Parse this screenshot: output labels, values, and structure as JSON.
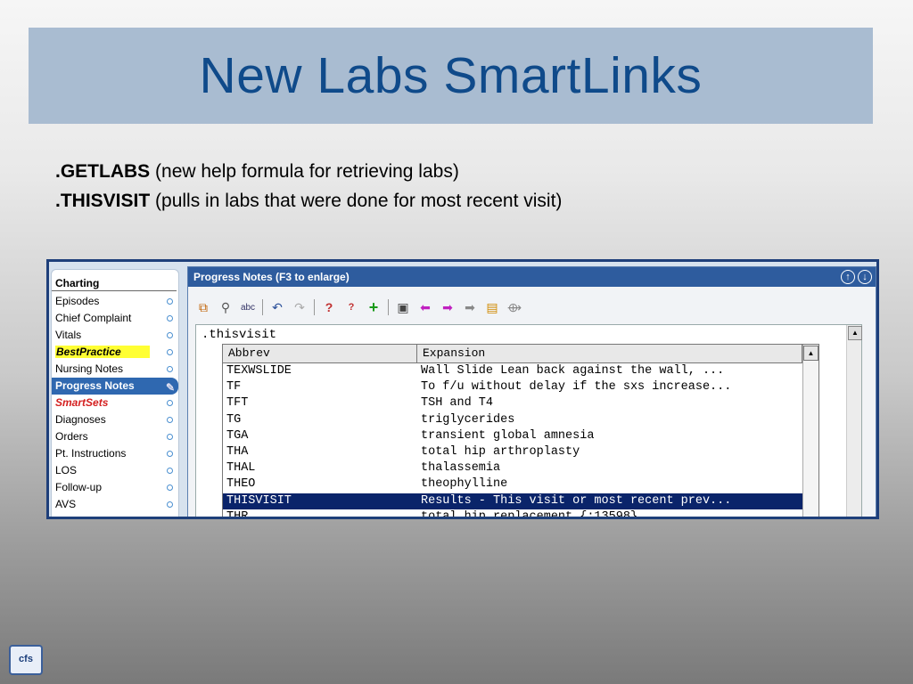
{
  "slide": {
    "title": "New Labs SmartLinks",
    "bullets": [
      {
        "code": ".GETLABS",
        "desc": "(new help formula for retrieving labs)"
      },
      {
        "code": ".THISVISIT",
        "desc": "(pulls in labs that were done for most recent visit)"
      }
    ]
  },
  "charting": {
    "header": "Charting",
    "items": [
      "Episodes",
      "Chief Complaint",
      "Vitals",
      "BestPractice",
      "Nursing Notes",
      "Progress Notes",
      "SmartSets",
      "Diagnoses",
      "Orders",
      "Pt. Instructions",
      "LOS",
      "Follow-up",
      "AVS"
    ]
  },
  "progress_notes": {
    "title": "Progress Notes (F3 to enlarge)",
    "editor_text": ".thisvisit",
    "columns": {
      "abbrev": "Abbrev",
      "expansion": "Expansion"
    },
    "rows": [
      {
        "abbrev": "TEXWSLIDE",
        "expansion": "Wall Slide  Lean back against the wall, ..."
      },
      {
        "abbrev": "TF",
        "expansion": "To f/u without delay if the sxs increase..."
      },
      {
        "abbrev": "TFT",
        "expansion": "TSH and T4"
      },
      {
        "abbrev": "TG",
        "expansion": "triglycerides"
      },
      {
        "abbrev": "TGA",
        "expansion": "transient global amnesia"
      },
      {
        "abbrev": "THA",
        "expansion": "total hip arthroplasty"
      },
      {
        "abbrev": "THAL",
        "expansion": "thalassemia"
      },
      {
        "abbrev": "THEO",
        "expansion": "theophylline"
      },
      {
        "abbrev": "THISVISIT",
        "expansion": "Results - This visit or most recent prev..."
      },
      {
        "abbrev": "THR",
        "expansion": "total hip replacement {:13598}"
      }
    ],
    "selected_abbrev": "THISVISIT"
  },
  "logo_text": "cfs"
}
